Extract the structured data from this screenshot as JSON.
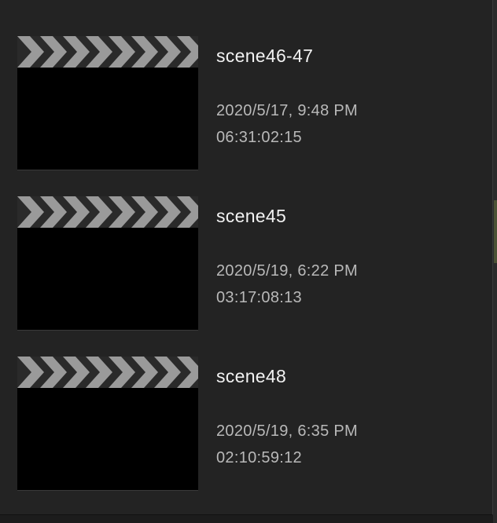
{
  "clips": [
    {
      "title": "scene46-47",
      "date": "2020/5/17, 9:48 PM",
      "duration": "06:31:02:15",
      "thumbnail_icon": "clapperboard-icon"
    },
    {
      "title": "scene45",
      "date": "2020/5/19, 6:22 PM",
      "duration": "03:17:08:13",
      "thumbnail_icon": "clapperboard-icon"
    },
    {
      "title": "scene48",
      "date": "2020/5/19, 6:35 PM",
      "duration": "02:10:59:12",
      "thumbnail_icon": "clapperboard-icon"
    }
  ],
  "colors": {
    "panel_background": "#232323",
    "title_text": "#f2f2f2",
    "meta_text": "#b9b9b9",
    "clapper_stripe": "#9a9a9a",
    "clapper_body": "#000000"
  }
}
